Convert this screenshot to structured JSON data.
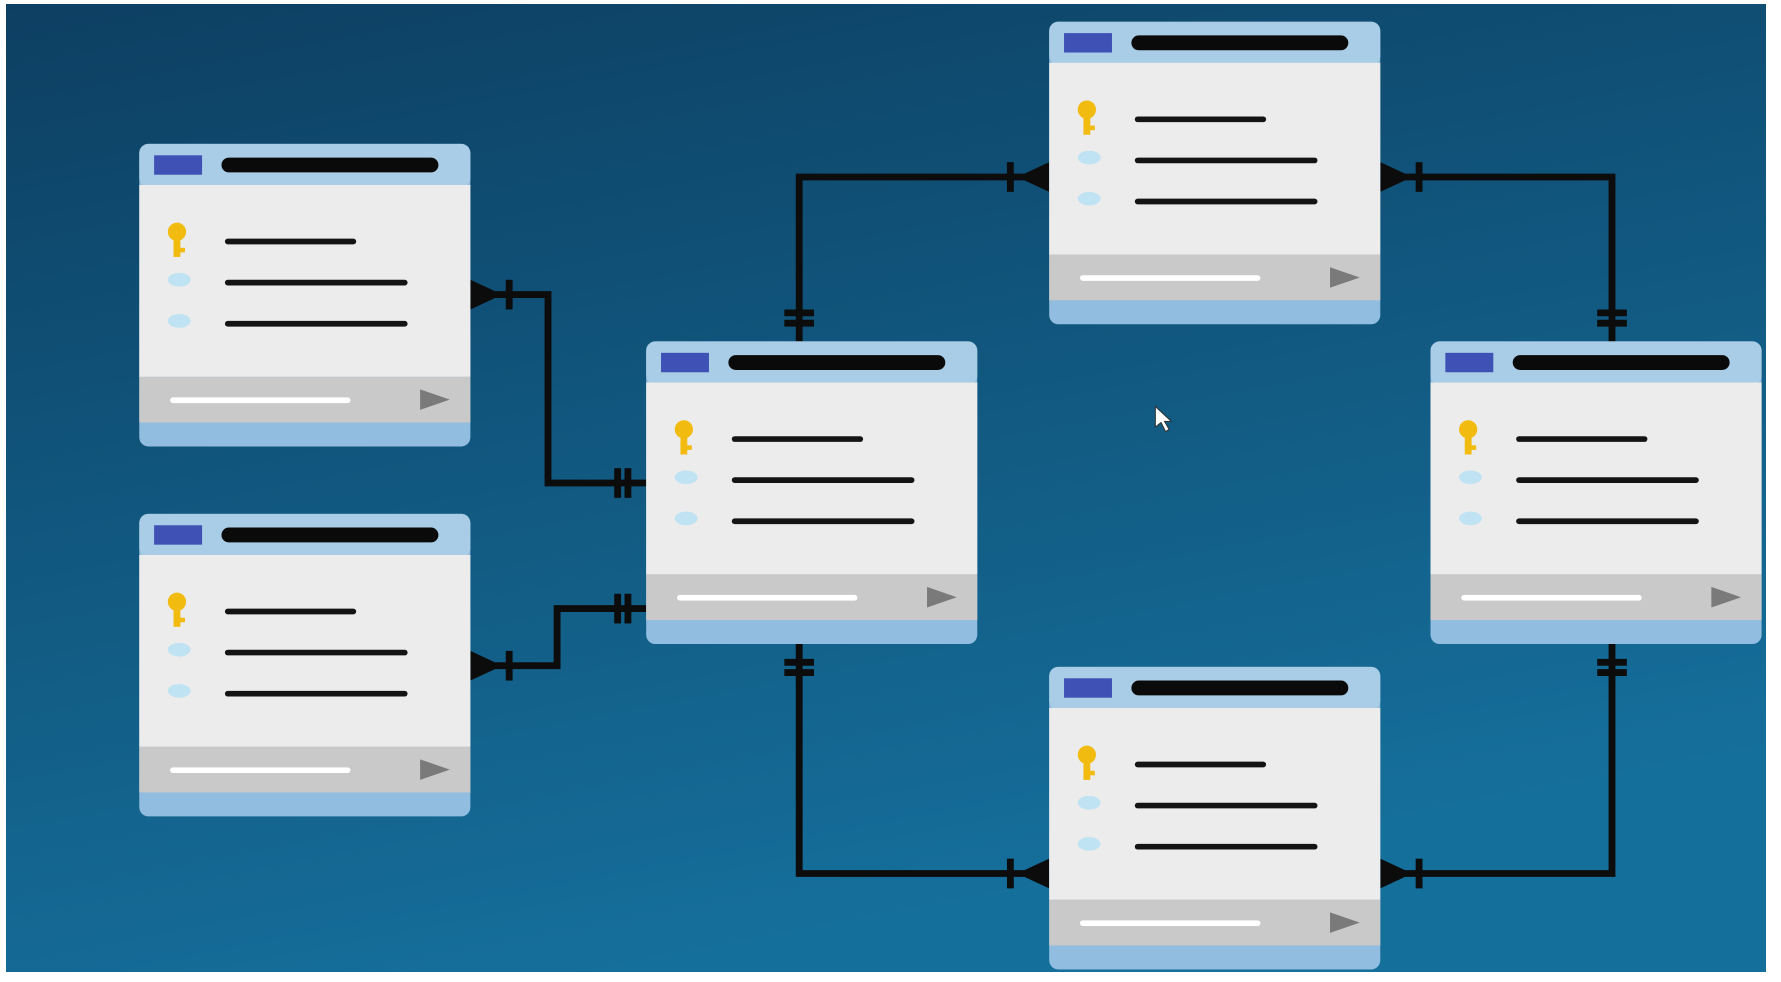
{
  "colors": {
    "background_top": "#0d3f62",
    "background_bottom": "#156f9b",
    "frame": "#ffffff",
    "card_body": "#ececec",
    "card_header": "#a9cde6",
    "card_footer_band": "#90bde0",
    "card_toolbar": "#c9c9c9",
    "header_square": "#3f51b5",
    "title_bar": "#0a0a0a",
    "field_line": "#141414",
    "key_icon": "#f2bb10",
    "field_dot": "#bfe3f2",
    "toolbar_line": "#ffffff",
    "play_icon": "#7a7a7a",
    "connector": "#0c0c0c",
    "cursor": "#ffffff"
  },
  "icons": {
    "primary_key": "key-icon",
    "field": "field-dot-icon",
    "toolbar_action": "play-icon",
    "pointer": "mouse-cursor-icon"
  },
  "entities": [
    {
      "id": "entity-top-left",
      "fields": [
        "primary-key",
        "field",
        "field"
      ]
    },
    {
      "id": "entity-bottom-left",
      "fields": [
        "primary-key",
        "field",
        "field"
      ]
    },
    {
      "id": "entity-center",
      "fields": [
        "primary-key",
        "field",
        "field"
      ]
    },
    {
      "id": "entity-top-middle",
      "fields": [
        "primary-key",
        "field",
        "field"
      ]
    },
    {
      "id": "entity-right",
      "fields": [
        "primary-key",
        "field",
        "field"
      ]
    },
    {
      "id": "entity-bottom-middle",
      "fields": [
        "primary-key",
        "field",
        "field"
      ]
    }
  ],
  "relationships": [
    {
      "id": "rel-top-left-center",
      "from": "entity-top-left",
      "to": "entity-center",
      "from_end": "many",
      "to_end": "one"
    },
    {
      "id": "rel-bottom-left-center",
      "from": "entity-bottom-left",
      "to": "entity-center",
      "from_end": "many",
      "to_end": "one"
    },
    {
      "id": "rel-center-top-middle",
      "from": "entity-center",
      "to": "entity-top-middle",
      "from_end": "one",
      "to_end": "many"
    },
    {
      "id": "rel-top-middle-right",
      "from": "entity-top-middle",
      "to": "entity-right",
      "from_end": "many",
      "to_end": "one"
    },
    {
      "id": "rel-center-bottom-middle",
      "from": "entity-center",
      "to": "entity-bottom-middle",
      "from_end": "one",
      "to_end": "many"
    },
    {
      "id": "rel-right-bottom-middle",
      "from": "entity-right",
      "to": "entity-bottom-middle",
      "from_end": "one",
      "to_end": "many"
    }
  ]
}
